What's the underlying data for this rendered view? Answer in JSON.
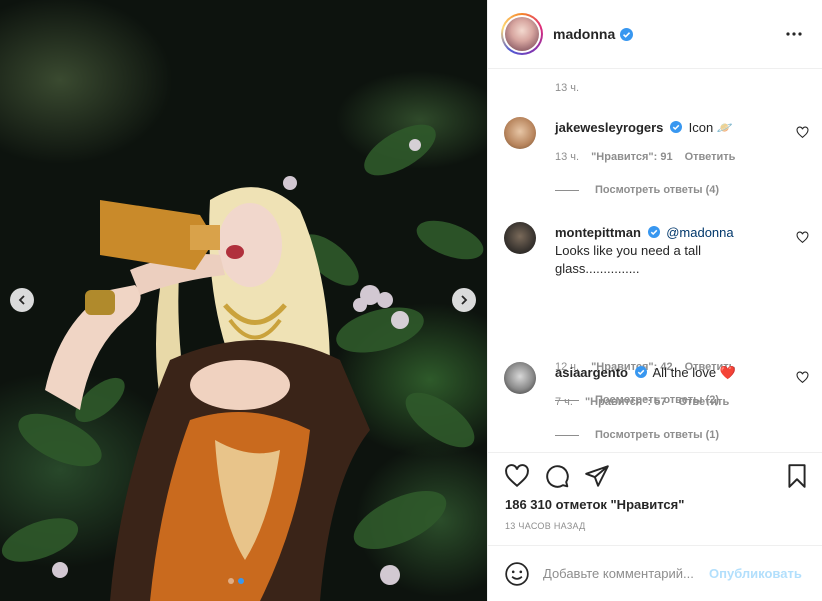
{
  "post": {
    "author": "madonna",
    "verified": true
  },
  "photo": {
    "carousel_dots": 2,
    "active_dot": 1
  },
  "comments": {
    "top_time": "13 ч.",
    "items": [
      {
        "user": "jakewesleyrogers",
        "verified": true,
        "text": "Icon 🪐",
        "time": "13 ч.",
        "likes": "\"Нравится\": 91",
        "reply": "Ответить",
        "view_replies": "Посмотреть ответы (4)"
      },
      {
        "user": "montepittman",
        "verified": true,
        "mention": "@madonna",
        "text": "Looks like you need a tall glass...............",
        "time": "12 ч.",
        "likes": "\"Нравится\": 42",
        "reply": "Ответить",
        "view_replies": "Посмотреть ответы (2)"
      },
      {
        "user": "asiaargento",
        "verified": true,
        "text": "All the love ❤️",
        "time": "7 ч.",
        "likes": "\"Нравится\": 57",
        "reply": "Ответить",
        "view_replies": "Посмотреть ответы (1)"
      }
    ]
  },
  "stats": {
    "likes": "186 310 отметок \"Нравится\"",
    "posted": "13 ЧАСОВ НАЗАД"
  },
  "add_comment": {
    "placeholder": "Добавьте комментарий...",
    "publish_label": "Опубликовать"
  },
  "colors": {
    "verified": "#3897f0",
    "link": "#00376b",
    "publish_disabled": "#b2dffc",
    "muted": "#8e8e8e"
  }
}
